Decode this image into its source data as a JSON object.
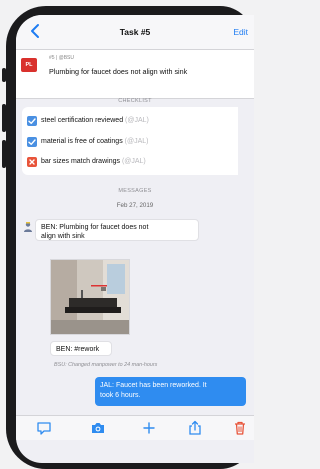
{
  "nav": {
    "title": "Task #5",
    "edit_label": "Edit"
  },
  "task": {
    "badge": "PL",
    "meta": "#5 | @BSU",
    "name": "Plumbing for faucet does not align with sink"
  },
  "checklist": {
    "heading": "CHECKLIST",
    "items": [
      {
        "text": "steel certification reviewed",
        "who": "(@JAL)",
        "state": "checked"
      },
      {
        "text": "material is free of coatings",
        "who": "(@JAL)",
        "state": "checked"
      },
      {
        "text": "bar sizes match drawings",
        "who": "(@JAL)",
        "state": "rejected"
      }
    ]
  },
  "messages": {
    "heading": "MESSAGES",
    "date": "Feb 27, 2019",
    "msg1_line1": "BEN: Plumbing for faucet does not",
    "msg1_line2": "align with sink",
    "msg2": "BEN: #rework",
    "system": "BSU: Changed manpower to 24 man-hours",
    "reply_line1": "JAL: Faucet has been reworked. It",
    "reply_line2": "took 6 hours."
  },
  "colors": {
    "accent": "#1e7cf2",
    "badge": "#d9312d",
    "check": "#4a90e2",
    "reject": "#e8543a",
    "bubble": "#2f8cf0"
  },
  "toolbar": {
    "icons": [
      "comment-icon",
      "camera-icon",
      "plus-icon",
      "share-icon",
      "trash-icon"
    ]
  }
}
